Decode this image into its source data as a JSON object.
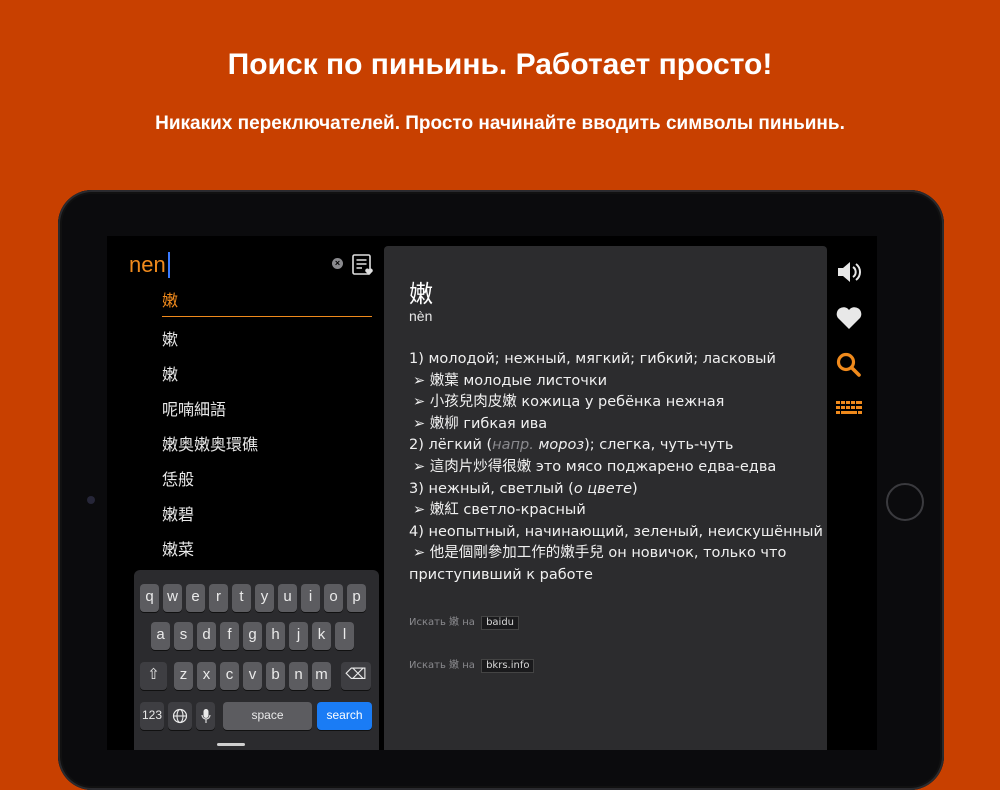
{
  "promo": {
    "headline": "Поиск по пиньинь. Работает просто!",
    "subline": "Никаких переключателей. Просто начинайте вводить символы пиньинь."
  },
  "search": {
    "value": "nen"
  },
  "results": [
    "嫩",
    "嫰",
    "嫩",
    "呢喃細語",
    "嫩奥嫩奥環礁",
    "恁般",
    "嫩碧",
    "嫩菜"
  ],
  "keyboard": {
    "row1": [
      "q",
      "w",
      "e",
      "r",
      "t",
      "y",
      "u",
      "i",
      "o",
      "p"
    ],
    "row2": [
      "a",
      "s",
      "d",
      "f",
      "g",
      "h",
      "j",
      "k",
      "l"
    ],
    "row3": [
      "z",
      "x",
      "c",
      "v",
      "b",
      "n",
      "m"
    ],
    "numbers_label": "123",
    "space_label": "space",
    "search_label": "search"
  },
  "detail": {
    "character": "嫩",
    "pinyin": "nèn",
    "lines": {
      "l1": "1) молодой; нежный, мягкий; гибкий; ласковый",
      "l2": "➢ 嫩葉 молодые листочки",
      "l3": "➢ 小孩兒肉皮嫩 кожица у ребёнка нежная",
      "l4": "➢ 嫩柳 гибкая ива",
      "l5a": "2) лёгкий (",
      "l5b": "напр.",
      "l5c": " мороз",
      "l5d": "); слегка, чуть-чуть",
      "l6": "➢ 這肉片炒得很嫩 это мясо поджарено едва-едва",
      "l7a": "3) нежный, светлый (",
      "l7b": "о цвете",
      "l7c": ")",
      "l8": "➢ 嫩紅 светло-красный",
      "l9": "4) неопытный, начинающий, зеленый, неискушённый",
      "l10": "➢ 他是個剛參加工作的嫩手兒 он новичок, только что",
      "l11": "приступивший к работе"
    },
    "link1": {
      "prefix": "Искать 嫩 на",
      "label": "baidu"
    },
    "link2": {
      "prefix": "Искать 嫩 на",
      "label": "bkrs.info"
    }
  },
  "colors": {
    "background": "#c84000",
    "accent": "#f08a1c",
    "keyboard_action": "#1a7cf5"
  },
  "icons": [
    "clear-icon",
    "favorites-list-icon",
    "speaker-icon",
    "heart-icon",
    "search-icon",
    "keyboard-icon",
    "shift-icon",
    "backspace-icon",
    "globe-icon",
    "microphone-icon"
  ]
}
